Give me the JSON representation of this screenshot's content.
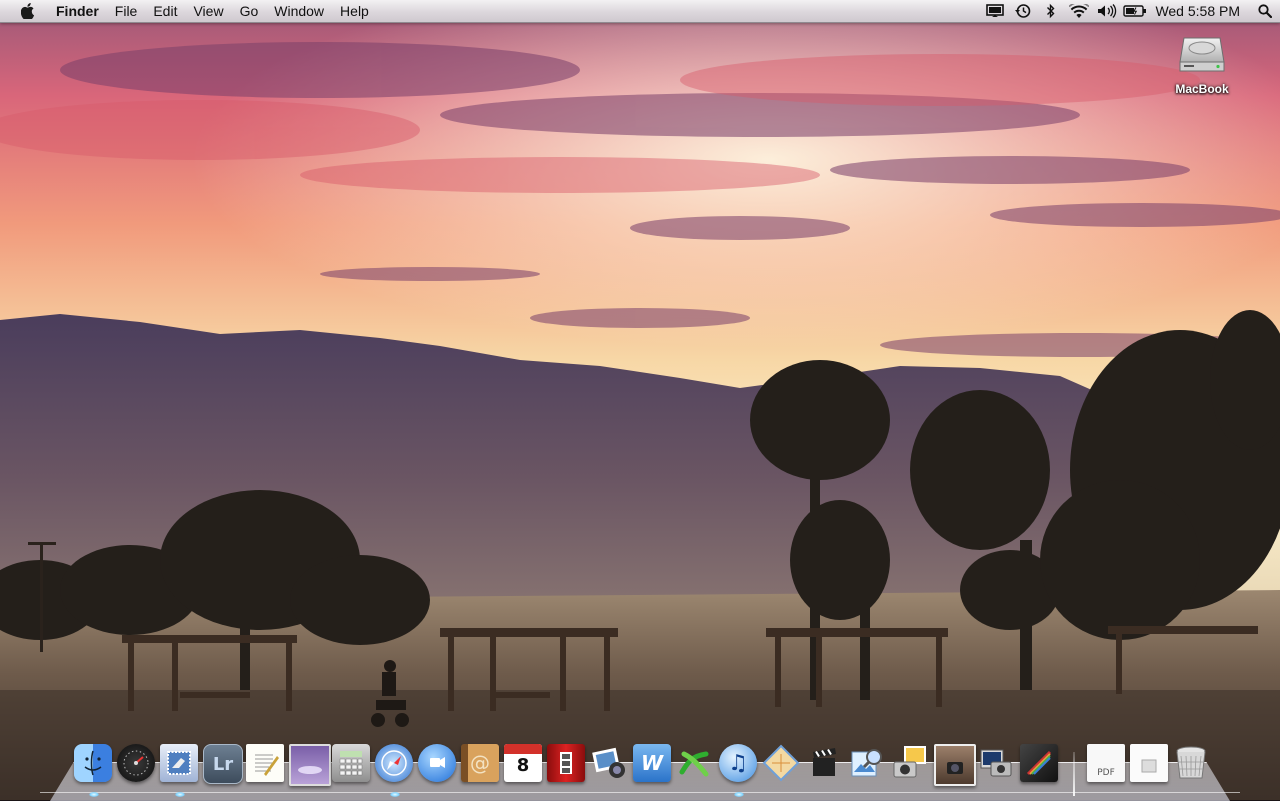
{
  "menubar": {
    "apple_icon": "apple-logo-icon",
    "app_name": "Finder",
    "menus": [
      "File",
      "Edit",
      "View",
      "Go",
      "Window",
      "Help"
    ],
    "status_icons": [
      "display-mirroring-icon",
      "time-machine-icon",
      "bluetooth-icon",
      "wifi-icon",
      "volume-icon",
      "battery-icon"
    ],
    "clock": "Wed 5:58 PM",
    "spotlight_icon": "spotlight-search-icon"
  },
  "desktop": {
    "drive_label": "MacBook"
  },
  "dock": {
    "apps": [
      {
        "name": "finder",
        "running": true
      },
      {
        "name": "dashboard",
        "running": false
      },
      {
        "name": "mail",
        "running": true
      },
      {
        "name": "lightroom",
        "label": "Lr",
        "running": false
      },
      {
        "name": "textedit",
        "running": false
      },
      {
        "name": "iphoto-slideshow",
        "running": false
      },
      {
        "name": "calculator",
        "running": false
      },
      {
        "name": "safari",
        "running": true
      },
      {
        "name": "ichat",
        "running": false
      },
      {
        "name": "address-book",
        "running": false
      },
      {
        "name": "ical",
        "date": "8",
        "running": false
      },
      {
        "name": "photo-booth",
        "running": false
      },
      {
        "name": "iphoto",
        "running": false
      },
      {
        "name": "iweb",
        "running": false
      },
      {
        "name": "xgrid",
        "running": false
      },
      {
        "name": "itunes",
        "running": true
      },
      {
        "name": "sketch-app",
        "running": false
      },
      {
        "name": "imovie",
        "running": false
      },
      {
        "name": "preview",
        "running": false
      },
      {
        "name": "image-capture",
        "running": false
      },
      {
        "name": "photo-organizer",
        "running": false
      },
      {
        "name": "screenshot-camera",
        "running": false
      },
      {
        "name": "remote-desktop",
        "running": false
      },
      {
        "name": "aperture",
        "running": false
      }
    ],
    "stacks": [
      {
        "name": "pdf-document-stack",
        "label": "PDF"
      },
      {
        "name": "documents-stack"
      },
      {
        "name": "trash"
      }
    ],
    "accent_running": "#7fd3ff"
  }
}
